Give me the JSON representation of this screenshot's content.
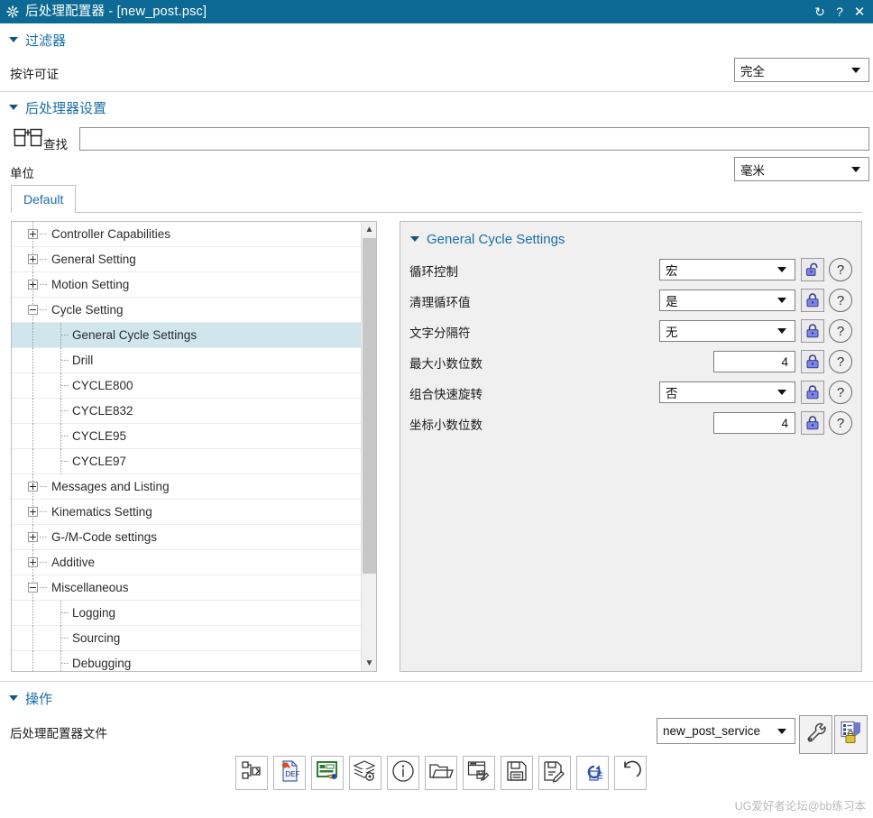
{
  "titlebar": {
    "gear_icon": "gear-icon",
    "title": "后处理配置器 - [new_post.psc]",
    "refresh_label": "↻",
    "help_label": "?",
    "close_label": "✕",
    "bg": "#0c6a94"
  },
  "filter": {
    "header": "过滤器",
    "license_label": "按许可证",
    "license_value": "完全"
  },
  "postproc": {
    "header": "后处理器设置",
    "find_icon": "binoculars-icon",
    "find_label": "查找",
    "find_value": "",
    "unit_label": "单位",
    "unit_value": "毫米",
    "tab": "Default"
  },
  "tree": {
    "items": [
      {
        "label": "Controller Capabilities",
        "depth": 0,
        "toggle": "plus",
        "selected": false
      },
      {
        "label": "General Setting",
        "depth": 0,
        "toggle": "plus",
        "selected": false
      },
      {
        "label": "Motion Setting",
        "depth": 0,
        "toggle": "plus",
        "selected": false
      },
      {
        "label": "Cycle Setting",
        "depth": 0,
        "toggle": "minus",
        "selected": false
      },
      {
        "label": "General Cycle Settings",
        "depth": 1,
        "toggle": "none",
        "selected": true
      },
      {
        "label": "Drill",
        "depth": 1,
        "toggle": "none",
        "selected": false
      },
      {
        "label": "CYCLE800",
        "depth": 1,
        "toggle": "none",
        "selected": false
      },
      {
        "label": "CYCLE832",
        "depth": 1,
        "toggle": "none",
        "selected": false
      },
      {
        "label": "CYCLE95",
        "depth": 1,
        "toggle": "none",
        "selected": false
      },
      {
        "label": "CYCLE97",
        "depth": 1,
        "toggle": "none",
        "selected": false
      },
      {
        "label": "Messages and Listing",
        "depth": 0,
        "toggle": "plus",
        "selected": false
      },
      {
        "label": "Kinematics Setting",
        "depth": 0,
        "toggle": "plus",
        "selected": false
      },
      {
        "label": "G-/M-Code settings",
        "depth": 0,
        "toggle": "plus",
        "selected": false
      },
      {
        "label": "Additive",
        "depth": 0,
        "toggle": "plus",
        "selected": false
      },
      {
        "label": "Miscellaneous",
        "depth": 0,
        "toggle": "minus",
        "selected": false
      },
      {
        "label": "Logging",
        "depth": 1,
        "toggle": "none",
        "selected": false
      },
      {
        "label": "Sourcing",
        "depth": 1,
        "toggle": "none",
        "selected": false
      },
      {
        "label": "Debugging",
        "depth": 1,
        "toggle": "none",
        "selected": false
      }
    ],
    "scroll_up_icon": "chevron-up-icon",
    "scroll_down_icon": "chevron-down-icon"
  },
  "detail": {
    "header": "General Cycle Settings",
    "help_label": "?",
    "rows": [
      {
        "label": "循环控制",
        "kind": "combo",
        "value": "宏",
        "lock": "unlocked"
      },
      {
        "label": "清理循环值",
        "kind": "combo",
        "value": "是",
        "lock": "locked"
      },
      {
        "label": "文字分隔符",
        "kind": "combo",
        "value": "无",
        "lock": "locked"
      },
      {
        "label": "最大小数位数",
        "kind": "text",
        "value": "4",
        "lock": "locked"
      },
      {
        "label": "组合快速旋转",
        "kind": "combo",
        "value": "否",
        "lock": "locked"
      },
      {
        "label": "坐标小数位数",
        "kind": "text",
        "value": "4",
        "lock": "locked"
      }
    ]
  },
  "operations": {
    "header": "操作",
    "file_label": "后处理配置器文件",
    "file_value": "new_post_service",
    "side_buttons": [
      {
        "icon": "wrench-icon"
      },
      {
        "icon": "list-lock-icon"
      }
    ],
    "toolbar": [
      {
        "icon": "flow-export-icon"
      },
      {
        "icon": "def-file-icon"
      },
      {
        "icon": "dialog-edit-icon"
      },
      {
        "icon": "layers-settings-icon"
      },
      {
        "icon": "info-icon"
      },
      {
        "icon": "open-folder-icon"
      },
      {
        "icon": "window-save-as-icon"
      },
      {
        "icon": "save-icon"
      },
      {
        "icon": "save-edit-icon"
      },
      {
        "icon": "refresh-docs-icon"
      },
      {
        "icon": "undo-icon"
      }
    ]
  },
  "watermark": {
    "text": "UG爱好者论坛@bb练习本"
  }
}
